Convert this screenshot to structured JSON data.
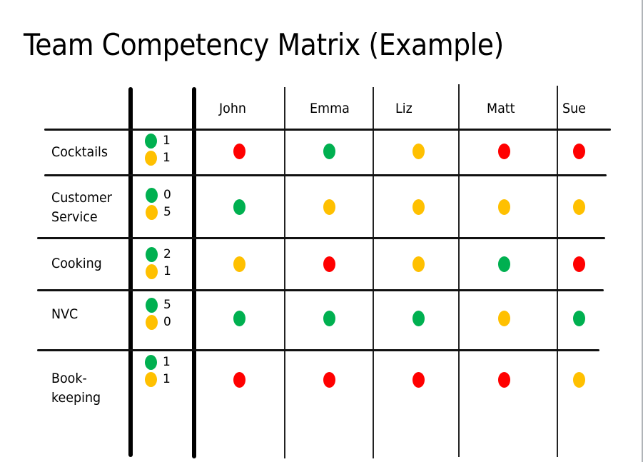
{
  "title": "Team Competency Matrix (Example)",
  "colors": {
    "green": "#00b050",
    "yellow": "#ffc000",
    "red": "#ff0000"
  },
  "people": [
    "John",
    "Emma",
    "Liz",
    "Matt",
    "Sue"
  ],
  "skills": [
    {
      "label_lines": [
        "Cocktails"
      ],
      "summary": {
        "green": "1",
        "yellow": "1"
      },
      "ratings": [
        "red",
        "green",
        "yellow",
        "red",
        "red"
      ]
    },
    {
      "label_lines": [
        "Customer",
        "Service"
      ],
      "summary": {
        "green": "0",
        "yellow": "5"
      },
      "ratings": [
        "green",
        "yellow",
        "yellow",
        "yellow",
        "yellow"
      ]
    },
    {
      "label_lines": [
        "Cooking"
      ],
      "summary": {
        "green": "2",
        "yellow": "1"
      },
      "ratings": [
        "yellow",
        "red",
        "yellow",
        "green",
        "red"
      ]
    },
    {
      "label_lines": [
        "NVC"
      ],
      "summary": {
        "green": "5",
        "yellow": "0"
      },
      "ratings": [
        "green",
        "green",
        "green",
        "yellow",
        "green"
      ]
    },
    {
      "label_lines": [
        "Book-",
        "keeping"
      ],
      "summary": {
        "green": "1",
        "yellow": "1"
      },
      "ratings": [
        "red",
        "red",
        "red",
        "red",
        "yellow"
      ]
    }
  ]
}
